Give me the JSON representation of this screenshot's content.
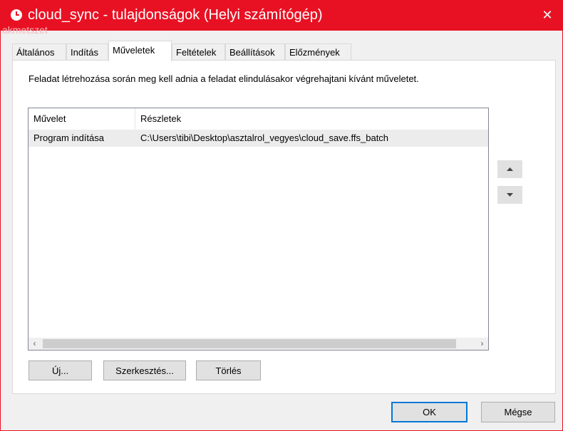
{
  "window": {
    "title": "cloud_sync - tulajdonságok (Helyi számítógép)",
    "close_glyph": "✕",
    "ghost_text": "akmetszet",
    "accent_color": "#e81123",
    "title_icon": "clock-icon"
  },
  "tabs": [
    {
      "label": "Általános",
      "active": false
    },
    {
      "label": "Indítás",
      "active": false
    },
    {
      "label": "Műveletek",
      "active": true
    },
    {
      "label": "Feltételek",
      "active": false
    },
    {
      "label": "Beállítások",
      "active": false
    },
    {
      "label": "Előzmények",
      "active": false
    }
  ],
  "actions_page": {
    "description": "Feladat létrehozása során meg kell adnia a feladat elindulásakor végrehajtani kívánt műveletet.",
    "columns": [
      "Művelet",
      "Részletek"
    ],
    "rows": [
      {
        "action": "Program indítása",
        "details": "C:\\Users\\tibi\\Desktop\\asztalrol_vegyes\\cloud_save.ffs_batch"
      }
    ],
    "move_up_icon": "triangle-up-icon",
    "move_down_icon": "triangle-down-icon",
    "scroll_left": "‹",
    "scroll_right": "›",
    "buttons": {
      "new": "Új...",
      "edit": "Szerkesztés...",
      "delete": "Törlés"
    }
  },
  "footer": {
    "ok": "OK",
    "cancel": "Mégse"
  }
}
